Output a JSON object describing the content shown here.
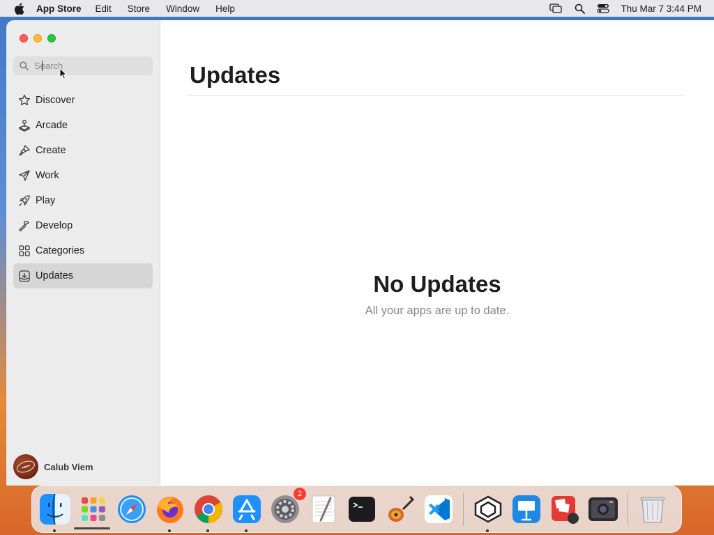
{
  "menubar": {
    "app_name": "App Store",
    "menus": [
      "Edit",
      "Store",
      "Window",
      "Help"
    ],
    "clock": "Thu Mar 7  3:44 PM",
    "icons": [
      "apple-icon",
      "screen-mirror-icon",
      "spotlight-icon",
      "control-center-icon"
    ]
  },
  "window": {
    "search": {
      "placeholder": "Search",
      "value": ""
    },
    "sidebar": {
      "items": [
        {
          "label": "Discover",
          "icon": "star-icon"
        },
        {
          "label": "Arcade",
          "icon": "joystick-icon"
        },
        {
          "label": "Create",
          "icon": "brush-icon"
        },
        {
          "label": "Work",
          "icon": "paper-plane-icon"
        },
        {
          "label": "Play",
          "icon": "rocket-icon"
        },
        {
          "label": "Develop",
          "icon": "hammer-icon"
        },
        {
          "label": "Categories",
          "icon": "grid-icon"
        },
        {
          "label": "Updates",
          "icon": "download-tray-icon",
          "active": true
        }
      ]
    },
    "user": {
      "name": "Calub Viem"
    },
    "main": {
      "title": "Updates",
      "empty_title": "No Updates",
      "empty_subtitle": "All your apps are up to date."
    }
  },
  "dock": {
    "apps": [
      {
        "name": "Finder",
        "running": true
      },
      {
        "name": "Launchpad",
        "running": false
      },
      {
        "name": "Safari",
        "running": false
      },
      {
        "name": "Firefox",
        "running": true
      },
      {
        "name": "Chrome",
        "running": true
      },
      {
        "name": "App Store",
        "running": true
      },
      {
        "name": "System Settings",
        "running": false,
        "badge": "2"
      },
      {
        "name": "TextEdit",
        "running": false
      },
      {
        "name": "Terminal",
        "running": false
      },
      {
        "name": "GarageBand",
        "running": false
      },
      {
        "name": "VS Code",
        "running": false
      },
      {
        "name": "Sketchup",
        "running": true
      },
      {
        "name": "Keynote",
        "running": false
      },
      {
        "name": "Photo Booth",
        "running": false
      },
      {
        "name": "Screenshot",
        "running": false
      },
      {
        "name": "Trash",
        "running": false
      }
    ]
  }
}
